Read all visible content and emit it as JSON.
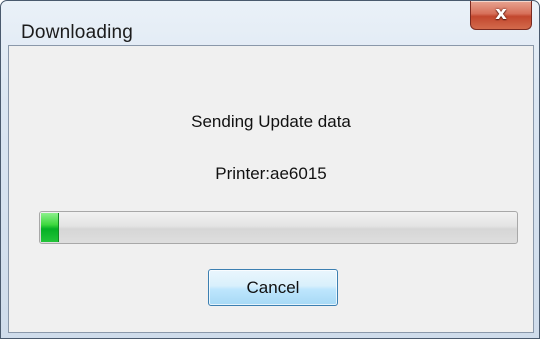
{
  "window": {
    "title": "Downloading",
    "close_label": "x"
  },
  "dialog": {
    "message": "Sending Update data",
    "printer_line": "Printer:ae6015",
    "progress_fraction": 0.035,
    "cancel_label": "Cancel"
  },
  "colors": {
    "progress_fill": "#06b025",
    "close_button": "#c2472e",
    "button_border": "#3c7fb1"
  }
}
